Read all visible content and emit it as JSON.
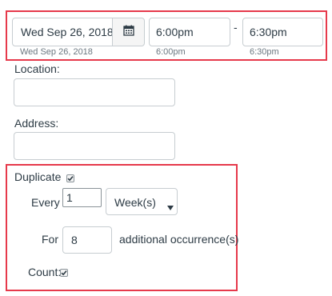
{
  "date_time": {
    "date_value": "Wed Sep 26, 2018",
    "date_hint": "Wed Sep 26, 2018",
    "start_time_value": "6:00pm",
    "start_time_hint": "6:00pm",
    "separator": "-",
    "end_time_value": "6:30pm",
    "end_time_hint": "6:30pm"
  },
  "location": {
    "label": "Location:",
    "value": ""
  },
  "address": {
    "label": "Address:",
    "value": ""
  },
  "duplicate": {
    "label": "Duplicate",
    "checked": true,
    "every_label": "Every",
    "every_value": "1",
    "frequency_selected": "Week(s)",
    "for_label": "For",
    "occurrences_value": "8",
    "occurrences_suffix": "additional occurrence(s)",
    "count_label": "Count:",
    "count_checked": true
  },
  "icons": {
    "calendar": "calendar-icon",
    "dropdown": "caret-down-icon",
    "check": "checkmark-icon"
  },
  "colors": {
    "highlight": "#e6394b",
    "border": "#c7cdd1",
    "text": "#2d3b45"
  }
}
